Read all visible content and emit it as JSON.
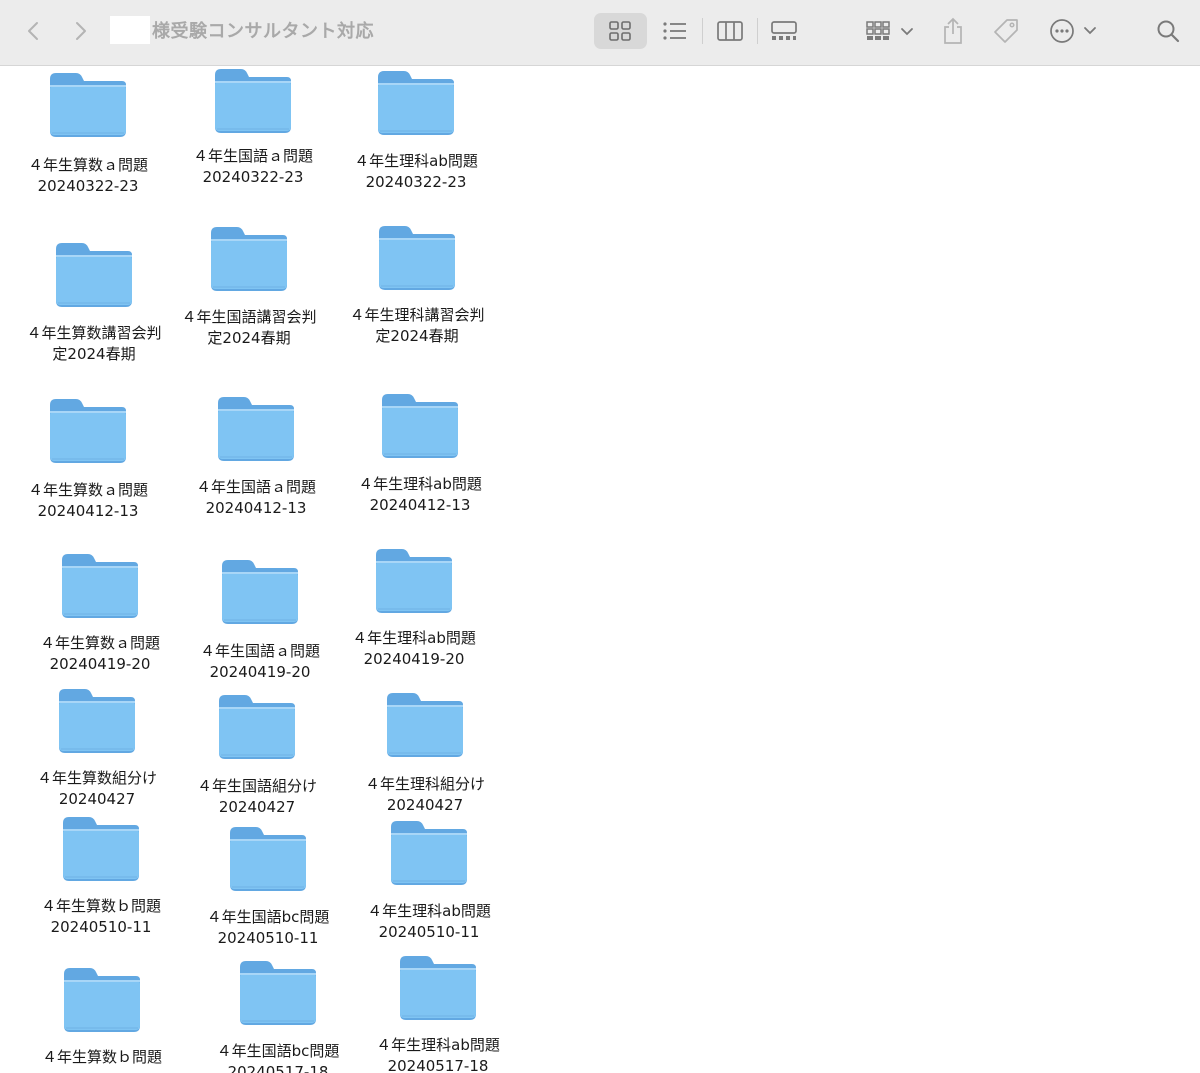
{
  "toolbar": {
    "title": "様受験コンサルタント対応",
    "icons": [
      "chevron-left",
      "chevron-right",
      "grid-view",
      "list-view",
      "column-view",
      "gallery-view",
      "group-by",
      "share",
      "tag",
      "more",
      "search"
    ]
  },
  "colors": {
    "folder_body": "#7fc4f3",
    "folder_tab": "#62a8e2",
    "toolbar_bg": "#ececec"
  },
  "folders": [
    {
      "name_line1": "４年生算数ａ問題",
      "name_line2": "20240322-23"
    },
    {
      "name_line1": "４年生国語ａ問題",
      "name_line2": "20240322-23"
    },
    {
      "name_line1": "４年生理科ab問題",
      "name_line2": "20240322-23"
    },
    {
      "name_line1": "４年生算数講習会判",
      "name_line2": "定2024春期"
    },
    {
      "name_line1": "４年生国語講習会判",
      "name_line2": "定2024春期"
    },
    {
      "name_line1": "４年生理科講習会判",
      "name_line2": "定2024春期"
    },
    {
      "name_line1": "４年生算数ａ問題",
      "name_line2": "20240412-13"
    },
    {
      "name_line1": "４年生国語ａ問題",
      "name_line2": "20240412-13"
    },
    {
      "name_line1": "４年生理科ab問題",
      "name_line2": "20240412-13"
    },
    {
      "name_line1": "４年生算数ａ問題",
      "name_line2": "20240419-20"
    },
    {
      "name_line1": "４年生国語ａ問題",
      "name_line2": "20240419-20"
    },
    {
      "name_line1": "４年生理科ab問題",
      "name_line2": "20240419-20"
    },
    {
      "name_line1": "４年生算数組分け",
      "name_line2": "20240427"
    },
    {
      "name_line1": "４年生国語組分け",
      "name_line2": "20240427"
    },
    {
      "name_line1": "４年生理科組分け",
      "name_line2": "20240427"
    },
    {
      "name_line1": "４年生算数ｂ問題",
      "name_line2": "20240510-11"
    },
    {
      "name_line1": "４年生国語bc問題",
      "name_line2": "20240510-11"
    },
    {
      "name_line1": "４年生理科ab問題",
      "name_line2": "20240510-11"
    },
    {
      "name_line1": "４年生算数ｂ問題",
      "name_line2": ""
    },
    {
      "name_line1": "４年生国語bc問題",
      "name_line2": "20240517-18"
    },
    {
      "name_line1": "４年生理科ab問題",
      "name_line2": "20240517-18"
    }
  ]
}
